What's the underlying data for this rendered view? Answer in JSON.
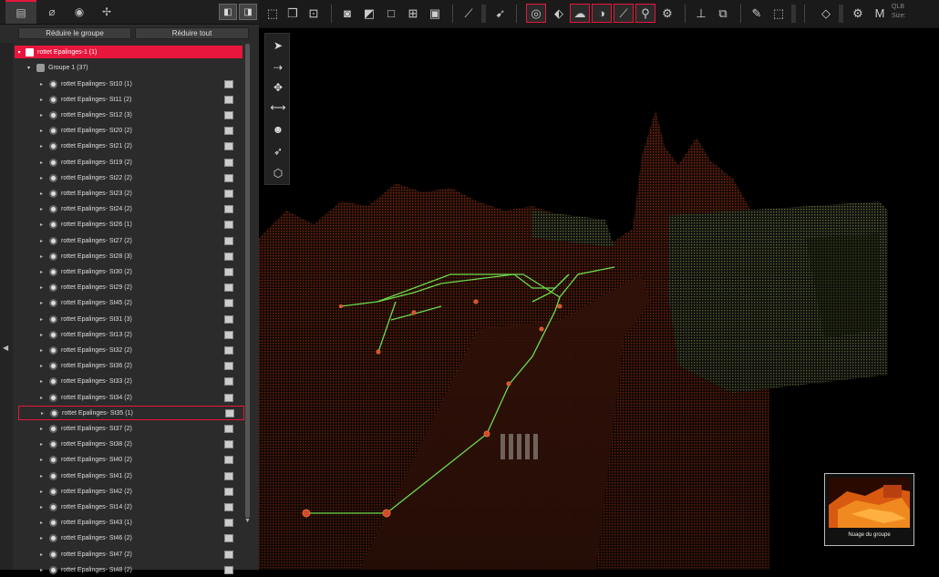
{
  "left_panel": {
    "tabs": [
      "layers-icon",
      "paperclip-icon",
      "globe-icon",
      "puzzle-icon"
    ],
    "collapse_group_label": "Réduire le groupe",
    "collapse_all_label": "Réduire tout",
    "root_label": "rottet Epalinges-1 (1)",
    "group_label": "Groupe 1 (37)",
    "stations": [
      "rottet Epalinges- St10 (1)",
      "rottet Epalinges- St11 (2)",
      "rottet Epalinges- St12 (3)",
      "rottet Epalinges- St20 (2)",
      "rottet Epalinges- St21 (2)",
      "rottet Epalinges- St19 (2)",
      "rottet Epalinges- St22 (2)",
      "rottet Epalinges- St23 (2)",
      "rottet Epalinges- St24 (2)",
      "rottet Epalinges- St26 (1)",
      "rottet Epalinges- St27 (2)",
      "rottet Epalinges- St28 (3)",
      "rottet Epalinges- St30 (2)",
      "rottet Epalinges- St29 (2)",
      "rottet Epalinges- St45 (2)",
      "rottet Epalinges- St31 (3)",
      "rottet Epalinges- St13 (2)",
      "rottet Epalinges- St32 (2)",
      "rottet Epalinges- St36 (2)",
      "rottet Epalinges- St33 (2)",
      "rottet Epalinges- St34 (2)",
      "rottet Epalinges- St35 (1)",
      "rottet Epalinges- St37 (2)",
      "rottet Epalinges- St38 (2)",
      "rottet Epalinges- St40 (2)",
      "rottet Epalinges- St41 (2)",
      "rottet Epalinges- St42 (2)",
      "rottet Epalinges- St14 (2)",
      "rottet Epalinges- St43 (1)",
      "rottet Epalinges- St46 (2)",
      "rottet Epalinges- St47 (2)",
      "rottet Epalinges- St48 (2)"
    ],
    "selected_station": "rottet Epalinges- St35 (1)"
  },
  "toolbar": {
    "qlb_label": "QLB",
    "size_label": "Size:"
  },
  "viewport": {
    "thumbnail_label": "Nuage du groupe"
  },
  "colors": {
    "accent": "#e8163c",
    "panel": "#2b2b2b",
    "path_green": "#6cdc4c"
  }
}
